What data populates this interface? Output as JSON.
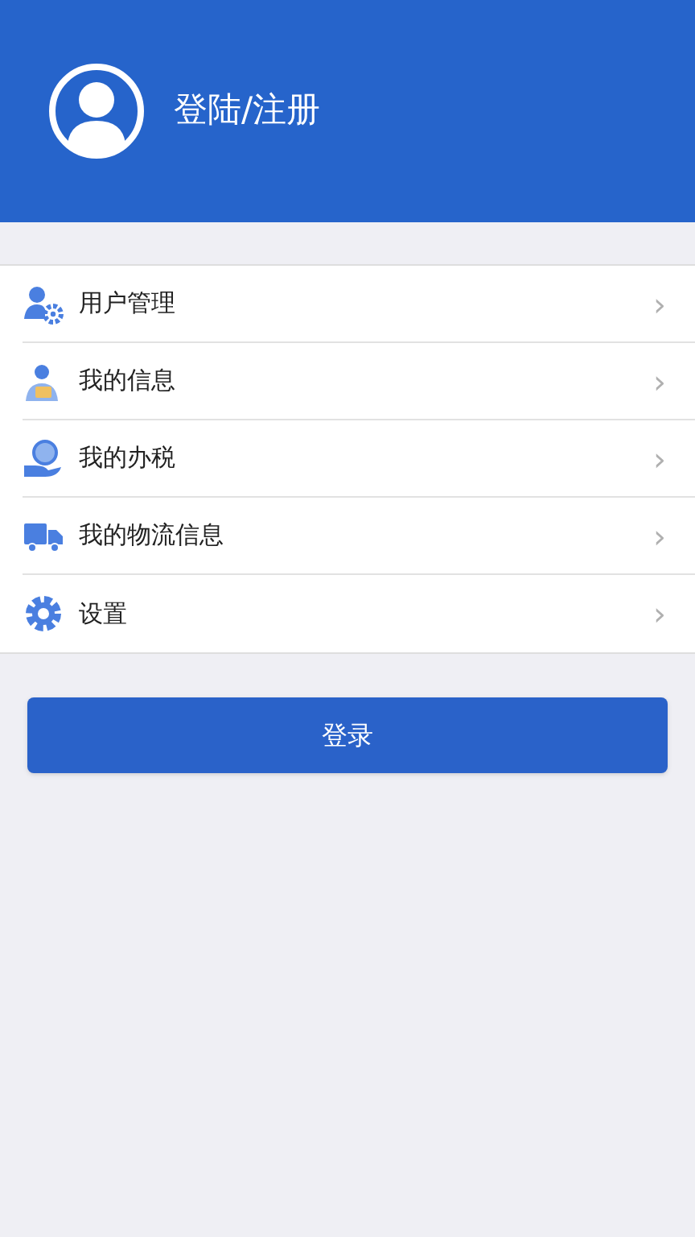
{
  "header": {
    "title": "登陆/注册"
  },
  "menu": [
    {
      "kind": "user-gear",
      "label": "用户管理",
      "chevron": "›"
    },
    {
      "kind": "person",
      "label": "我的信息",
      "chevron": "›"
    },
    {
      "kind": "hand",
      "label": "我的办税",
      "chevron": "›"
    },
    {
      "kind": "truck",
      "label": "我的物流信息",
      "chevron": "›"
    },
    {
      "kind": "gear",
      "label": "设置",
      "chevron": "›"
    }
  ],
  "login_button": "登录"
}
